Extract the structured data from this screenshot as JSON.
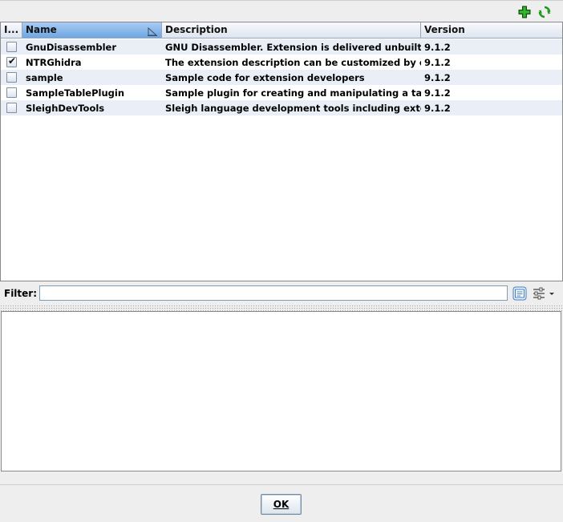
{
  "toolbar": {
    "add_icon": "add-plus-icon",
    "refresh_icon": "refresh-icon"
  },
  "table": {
    "columns": [
      "I...",
      "Name",
      "Description",
      "Version"
    ],
    "sorted_column": "Name",
    "rows": [
      {
        "installed": false,
        "name": "GnuDisassembler",
        "description": "GNU Disassembler.  Extension is delivered unbuilt.  S...",
        "version": "9.1.2"
      },
      {
        "installed": true,
        "name": "NTRGhidra",
        "description": "The extension description can be customized by editi...",
        "version": "9.1.2"
      },
      {
        "installed": false,
        "name": "sample",
        "description": "Sample code for extension developers",
        "version": "9.1.2"
      },
      {
        "installed": false,
        "name": "SampleTablePlugin",
        "description": "Sample plugin for creating and manipulating a table",
        "version": "9.1.2"
      },
      {
        "installed": false,
        "name": "SleighDevTools",
        "description": "Sleigh language development tools including external...",
        "version": "9.1.2"
      }
    ],
    "check_mark": "✔"
  },
  "filter": {
    "label": "Filter:",
    "value": ""
  },
  "footer": {
    "ok_label": "OK"
  },
  "colors": {
    "row_alt": "#e9eef7",
    "header_sorted": "#6ea6e3"
  }
}
